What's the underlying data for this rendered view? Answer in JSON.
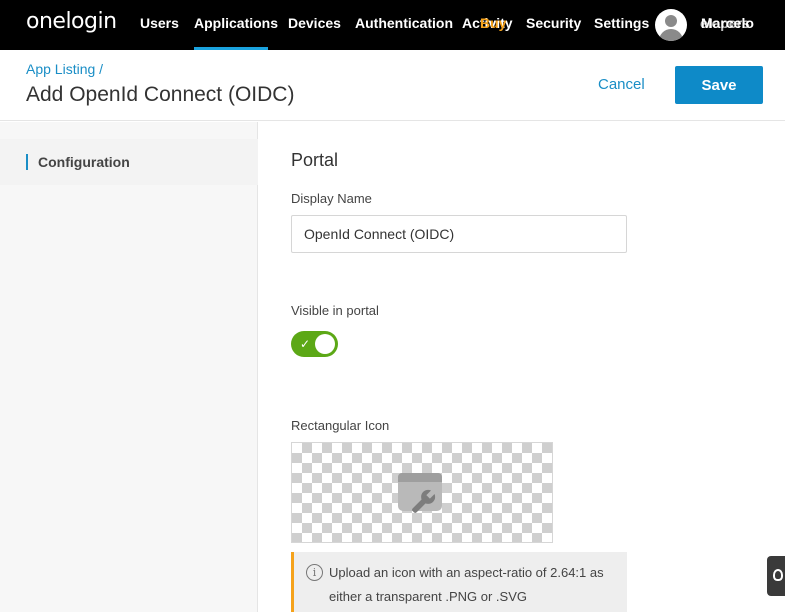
{
  "nav": {
    "logo": "onelogin",
    "items": [
      "Users",
      "Applications",
      "Devices",
      "Authentication",
      "Activity",
      "Security",
      "Settings"
    ],
    "active": "Applications",
    "badge": "Buy",
    "account_overlay": "elopers",
    "account_name": "Marcelo"
  },
  "header": {
    "breadcrumb": "App Listing /",
    "title": "Add OpenId Connect (OIDC)",
    "cancel_label": "Cancel",
    "save_label": "Save"
  },
  "sidebar": {
    "items": [
      {
        "label": "Configuration",
        "active": true
      }
    ]
  },
  "portal": {
    "section_title": "Portal",
    "display_name_label": "Display Name",
    "display_name_value": "OpenId Connect (OIDC)",
    "visible_label": "Visible in portal",
    "visible_on": true,
    "rect_icon_label": "Rectangular Icon",
    "info_text": "Upload an icon with an aspect-ratio of 2.64:1 as either a transparent .PNG or .SVG"
  },
  "icons": {
    "info": "info-icon",
    "placeholder": "app-placeholder-wrench-icon",
    "toggle_check": "check-icon",
    "help": "help-icon"
  },
  "colors": {
    "nav_bg": "#000000",
    "accent": "#1a8ec6",
    "save_bg": "#0e8ac8",
    "toggle_on": "#5ca816",
    "badge": "#f5a21b",
    "info_border": "#f5a21b"
  }
}
